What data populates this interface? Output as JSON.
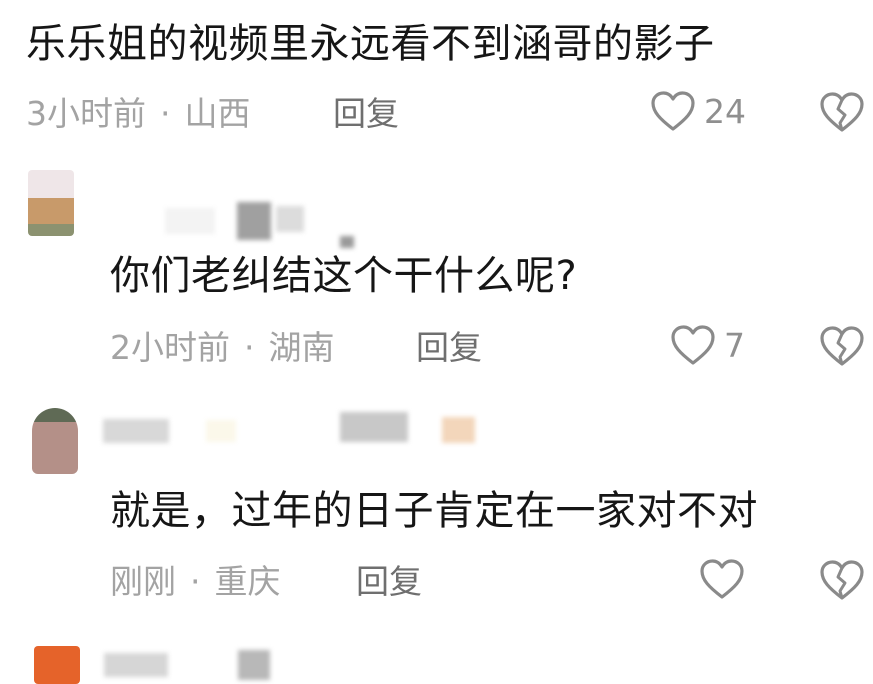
{
  "comments": [
    {
      "text": "乐乐姐的视频里永远看不到涵哥的影子",
      "time": "3小时前",
      "location": "山西",
      "reply_label": "回复",
      "likes": "24"
    },
    {
      "text": "你们老纠结这个干什么呢?",
      "time": "2小时前",
      "location": "湖南",
      "reply_label": "回复",
      "likes": "7"
    },
    {
      "text": "就是，过年的日子肯定在一家对不对",
      "time": "刚刚",
      "location": "重庆",
      "reply_label": "回复",
      "likes": ""
    }
  ],
  "meta_separator": "·",
  "colors": {
    "text_primary": "#161616",
    "text_meta": "#a3a3a3",
    "reply": "#6f6f6f",
    "icon_stroke": "#8a8a8a"
  },
  "icons": {
    "like": "heart-outline-icon",
    "dislike": "broken-heart-icon"
  }
}
